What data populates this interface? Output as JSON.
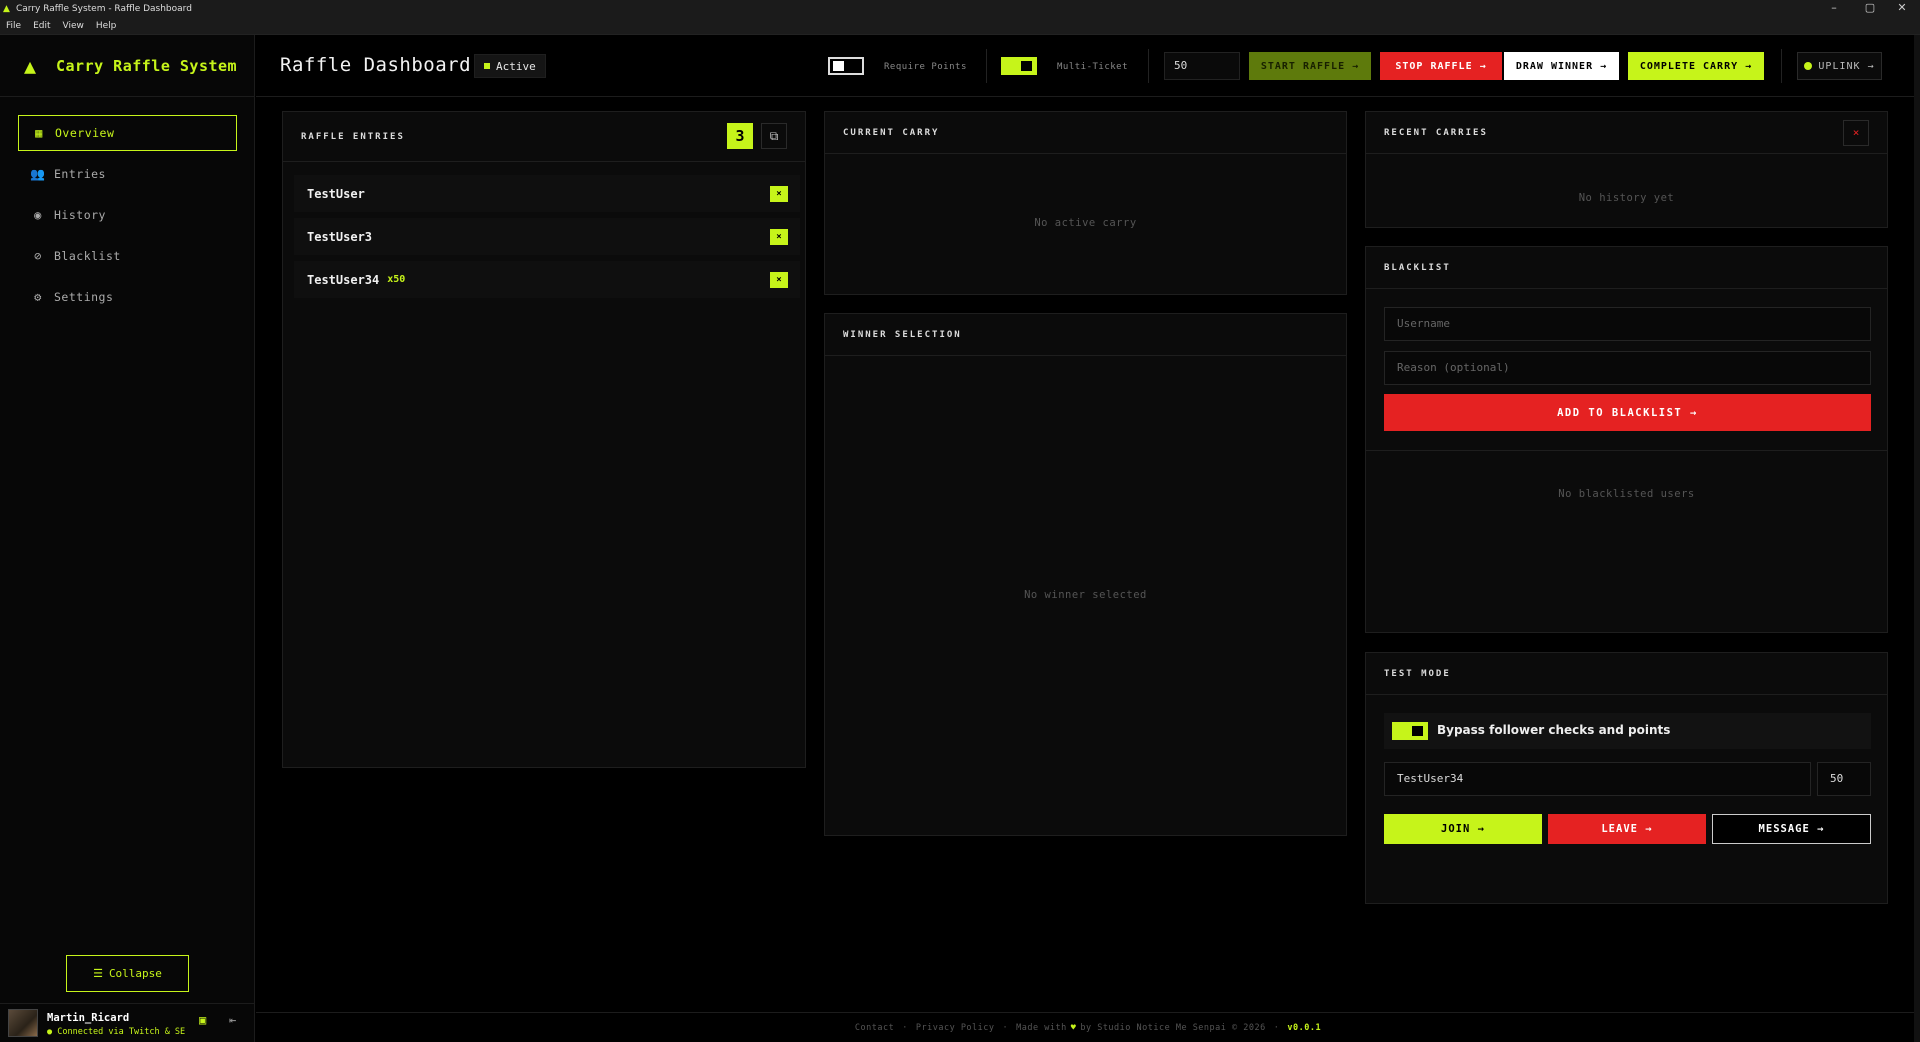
{
  "window": {
    "title": "Carry Raffle System - Raffle Dashboard",
    "controls": {
      "minimize": "–",
      "restore": "▢",
      "close": "✕"
    }
  },
  "menu": [
    "File",
    "Edit",
    "View",
    "Help"
  ],
  "brand": {
    "name": "Carry Raffle System"
  },
  "nav": [
    {
      "label": "Overview",
      "icon": "dashboard-icon",
      "active": true
    },
    {
      "label": "Entries",
      "icon": "users-icon"
    },
    {
      "label": "History",
      "icon": "history-icon"
    },
    {
      "label": "Blacklist",
      "icon": "block-icon"
    },
    {
      "label": "Settings",
      "icon": "gear-icon"
    }
  ],
  "sidebar": {
    "collapse_label": "Collapse",
    "user": {
      "name": "Martin_Ricard",
      "status": "● Connected via Twitch & SE"
    }
  },
  "header": {
    "title": "Raffle Dashboard",
    "status": "Active",
    "require_points": {
      "label": "Require Points",
      "on": false
    },
    "multi_ticket": {
      "label": "Multi-Ticket",
      "on": true
    },
    "points_value": "50",
    "buttons": {
      "start": "START RAFFLE →",
      "stop": "STOP RAFFLE →",
      "draw": "DRAW WINNER →",
      "complete": "COMPLETE CARRY →",
      "uplink": "UPLINK →"
    }
  },
  "entries_panel": {
    "title": "RAFFLE ENTRIES",
    "count": "3",
    "entries": [
      {
        "name": "TestUser",
        "mult": ""
      },
      {
        "name": "TestUser3",
        "mult": ""
      },
      {
        "name": "TestUser34",
        "mult": "x50"
      }
    ],
    "remove_glyph": "×"
  },
  "current_carry": {
    "title": "CURRENT CARRY",
    "empty": "No active carry"
  },
  "winner_selection": {
    "title": "WINNER SELECTION",
    "empty": "No winner selected"
  },
  "recent_carries": {
    "title": "RECENT CARRIES",
    "empty": "No history yet",
    "clear_glyph": "×"
  },
  "blacklist": {
    "title": "BLACKLIST",
    "username_placeholder": "Username",
    "reason_placeholder": "Reason (optional)",
    "add_label": "ADD TO BLACKLIST →",
    "empty": "No blacklisted users"
  },
  "test_mode": {
    "title": "TEST MODE",
    "bypass_label": "Bypass follower checks and points",
    "bypass_on": true,
    "username_value": "TestUser34",
    "points_value": "50",
    "join": "JOIN →",
    "leave": "LEAVE →",
    "message": "MESSAGE →"
  },
  "footer": {
    "contact": "Contact",
    "privacy": "Privacy Policy",
    "made_with": "Made with",
    "by": "by Studio Notice Me Senpai © 2026",
    "version": "v0.0.1"
  },
  "colors": {
    "accent": "#c6f41a",
    "danger": "#e52222",
    "bg": "#000000",
    "panel": "#0b0b0b"
  }
}
